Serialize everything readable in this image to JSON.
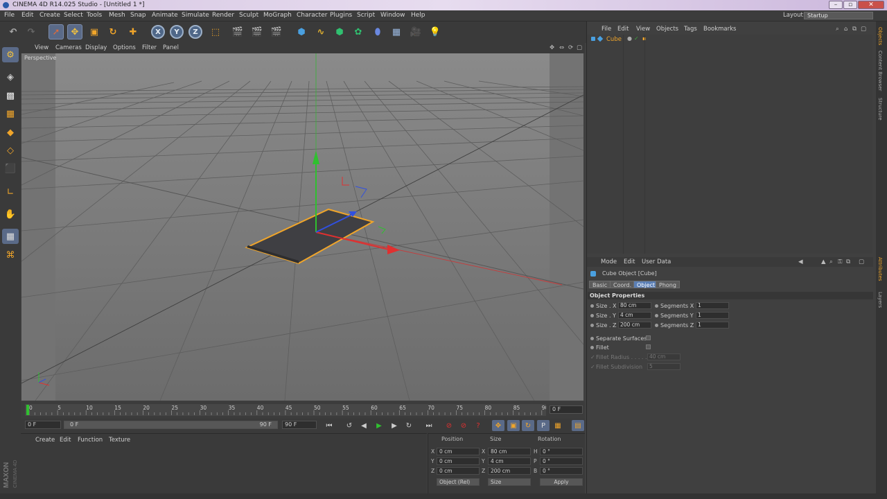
{
  "window": {
    "title": "CINEMA 4D R14.025 Studio - [Untitled 1 *]"
  },
  "menubar": {
    "items": [
      "File",
      "Edit",
      "Create",
      "Select",
      "Tools",
      "Mesh",
      "Snap",
      "Animate",
      "Simulate",
      "Render",
      "Sculpt",
      "MoGraph",
      "Character",
      "Plugins",
      "Script",
      "Window",
      "Help"
    ]
  },
  "layout": {
    "label": "Layout:",
    "value": "Startup"
  },
  "viewport": {
    "menu": [
      "View",
      "Cameras",
      "Display",
      "Options",
      "Filter",
      "Panel"
    ],
    "label": "Perspective"
  },
  "timeline": {
    "ticks": [
      "0",
      "5",
      "10",
      "15",
      "20",
      "25",
      "30",
      "35",
      "40",
      "45",
      "50",
      "55",
      "60",
      "65",
      "70",
      "75",
      "80",
      "85",
      "90"
    ],
    "end_field": "0 F",
    "start_frame": "0 F",
    "slider_start": "0 F",
    "slider_end": "90 F",
    "end_frame": "90 F"
  },
  "material": {
    "menu": [
      "Create",
      "Edit",
      "Function",
      "Texture"
    ]
  },
  "coords": {
    "headers": {
      "position": "Position",
      "size": "Size",
      "rotation": "Rotation"
    },
    "rows": [
      {
        "axis": "X",
        "pos": "0 cm",
        "size_axis": "X",
        "size": "80 cm",
        "rot_axis": "H",
        "rot": "0 °"
      },
      {
        "axis": "Y",
        "pos": "0 cm",
        "size_axis": "Y",
        "size": "4 cm",
        "rot_axis": "P",
        "rot": "0 °"
      },
      {
        "axis": "Z",
        "pos": "0 cm",
        "size_axis": "Z",
        "size": "200 cm",
        "rot_axis": "B",
        "rot": "0 °"
      }
    ],
    "mode": "Object (Rel)",
    "size_mode": "Size",
    "apply": "Apply"
  },
  "objects": {
    "menu": [
      "File",
      "Edit",
      "View",
      "Objects",
      "Tags",
      "Bookmarks"
    ],
    "items": [
      {
        "name": "Cube"
      }
    ]
  },
  "attributes": {
    "menu": [
      "Mode",
      "Edit",
      "User Data"
    ],
    "title": "Cube Object [Cube]",
    "tabs": [
      "Basic",
      "Coord.",
      "Object",
      "Phong"
    ],
    "active_tab": "Object",
    "section": "Object Properties",
    "size_x_label": "Size . X",
    "size_x": "80 cm",
    "size_y_label": "Size . Y",
    "size_y": "4 cm",
    "size_z_label": "Size . Z",
    "size_z": "200 cm",
    "seg_x_label": "Segments X",
    "seg_x": "1",
    "seg_y_label": "Segments Y",
    "seg_y": "1",
    "seg_z_label": "Segments Z",
    "seg_z": "1",
    "separate_surfaces": "Separate Surfaces",
    "fillet": "Fillet",
    "fillet_radius_label": "Fillet Radius . . . . .",
    "fillet_radius": "40 cm",
    "fillet_subdiv_label": "Fillet Subdivision",
    "fillet_subdiv": "5"
  },
  "right_strip": {
    "tabs": [
      "Objects",
      "Content Browser",
      "Structure",
      "Attributes",
      "Layers"
    ]
  },
  "branding": {
    "maxon": "MAXON",
    "product": "CINEMA 4D"
  },
  "colors": {
    "accent": "#f0a52a",
    "x_axis": "#e03030",
    "y_axis": "#30c030",
    "z_axis": "#3050e0",
    "selection": "#5b7fb5"
  }
}
